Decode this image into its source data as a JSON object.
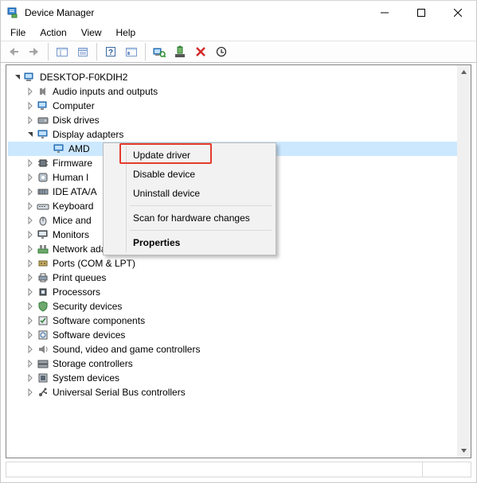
{
  "window": {
    "title": "Device Manager"
  },
  "menus": [
    "File",
    "Action",
    "View",
    "Help"
  ],
  "tree": {
    "root": "DESKTOP-F0KDIH2",
    "nodes": [
      {
        "label": "Audio inputs and outputs",
        "icon": "audio"
      },
      {
        "label": "Computer",
        "icon": "computer"
      },
      {
        "label": "Disk drives",
        "icon": "disk"
      },
      {
        "label": "Display adapters",
        "icon": "display",
        "expanded": true,
        "children": [
          {
            "label": "AMD",
            "icon": "display",
            "selected": true
          }
        ]
      },
      {
        "label": "Firmware",
        "icon": "chip"
      },
      {
        "label": "Human Interface Devices",
        "icon": "hid",
        "truncated": "Human I"
      },
      {
        "label": "IDE ATA/ATAPI controllers",
        "icon": "ide",
        "truncated": "IDE ATA/A"
      },
      {
        "label": "Keyboards",
        "icon": "keyboard",
        "truncated": "Keyboard"
      },
      {
        "label": "Mice and other pointing devices",
        "icon": "mouse",
        "truncated": "Mice and"
      },
      {
        "label": "Monitors",
        "icon": "monitor"
      },
      {
        "label": "Network adapters",
        "icon": "network"
      },
      {
        "label": "Ports (COM & LPT)",
        "icon": "port"
      },
      {
        "label": "Print queues",
        "icon": "printer"
      },
      {
        "label": "Processors",
        "icon": "cpu"
      },
      {
        "label": "Security devices",
        "icon": "security"
      },
      {
        "label": "Software components",
        "icon": "swcomp"
      },
      {
        "label": "Software devices",
        "icon": "swdev"
      },
      {
        "label": "Sound, video and game controllers",
        "icon": "sound"
      },
      {
        "label": "Storage controllers",
        "icon": "storage"
      },
      {
        "label": "System devices",
        "icon": "system"
      },
      {
        "label": "Universal Serial Bus controllers",
        "icon": "usb"
      }
    ]
  },
  "context_menu": {
    "items": [
      {
        "label": "Update driver",
        "highlighted": true
      },
      {
        "label": "Disable device"
      },
      {
        "label": "Uninstall device"
      },
      {
        "separator": true
      },
      {
        "label": "Scan for hardware changes"
      },
      {
        "separator": true
      },
      {
        "label": "Properties",
        "bold": true
      }
    ]
  }
}
